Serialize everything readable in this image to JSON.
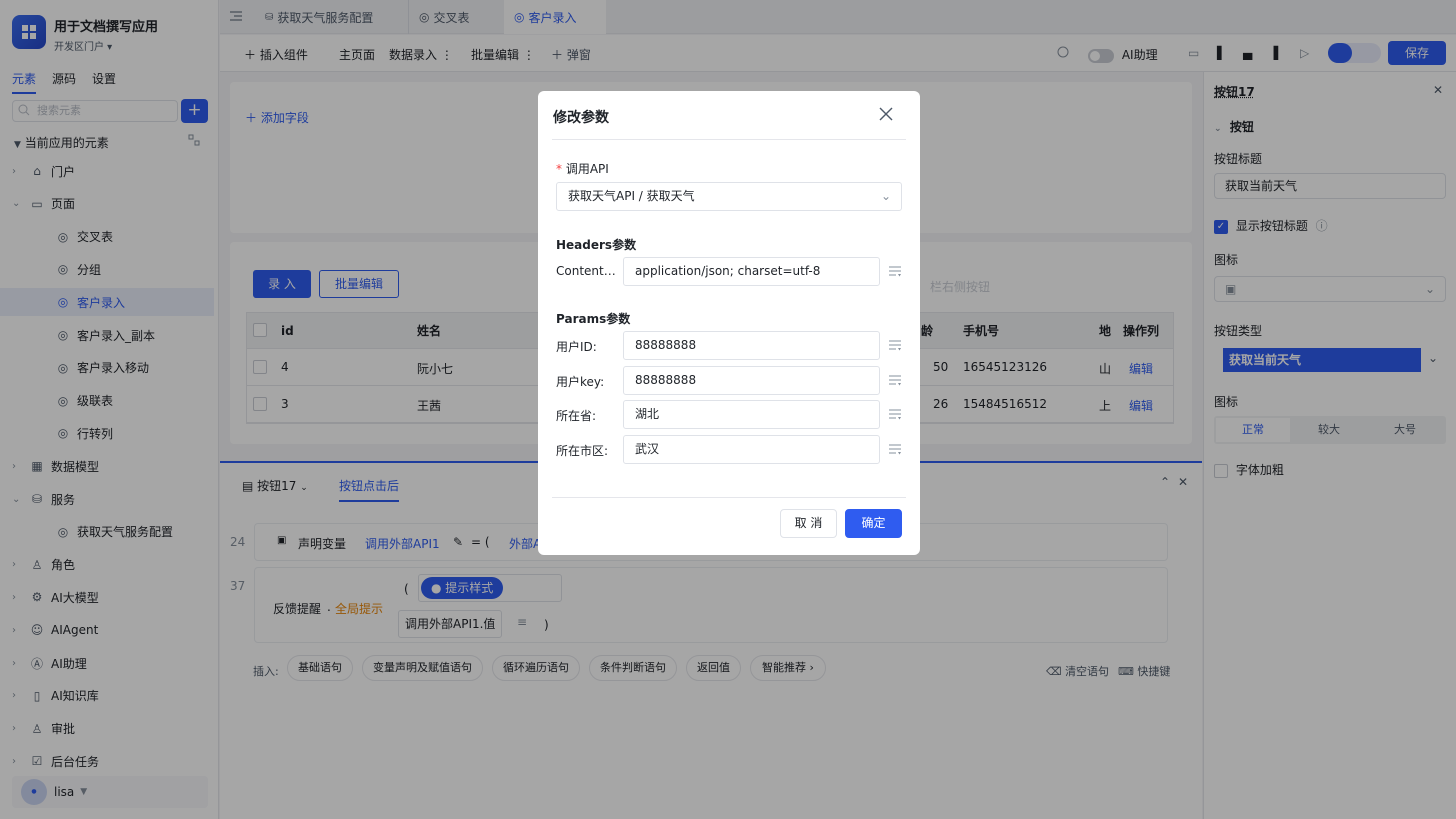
{
  "app": {
    "title": "用于文档撰写应用",
    "subtitle": "开发区门户"
  },
  "sidebar": {
    "tabs": [
      "元素",
      "源码",
      "设置"
    ],
    "search_placeholder": "搜索元素",
    "section_title": "当前应用的元素",
    "items": [
      {
        "label": "门户",
        "level": 0,
        "arrow": "›"
      },
      {
        "label": "页面",
        "level": 0,
        "arrow": "⌄"
      },
      {
        "label": "交叉表",
        "level": 1
      },
      {
        "label": "分组",
        "level": 1
      },
      {
        "label": "客户录入",
        "level": 1,
        "selected": true
      },
      {
        "label": "客户录入_副本",
        "level": 1
      },
      {
        "label": "客户录入移动",
        "level": 1
      },
      {
        "label": "级联表",
        "level": 1
      },
      {
        "label": "行转列",
        "level": 1
      },
      {
        "label": "数据模型",
        "level": 0,
        "arrow": "›"
      },
      {
        "label": "服务",
        "level": 0,
        "arrow": "⌄"
      },
      {
        "label": "获取天气服务配置",
        "level": 1
      },
      {
        "label": "角色",
        "level": 0,
        "arrow": "›"
      },
      {
        "label": "AI大模型",
        "level": 0,
        "arrow": "›"
      },
      {
        "label": "AIAgent",
        "level": 0,
        "arrow": "›"
      },
      {
        "label": "AI助理",
        "level": 0,
        "arrow": "›"
      },
      {
        "label": "AI知识库",
        "level": 0,
        "arrow": "›"
      },
      {
        "label": "审批",
        "level": 0,
        "arrow": "›"
      },
      {
        "label": "后台任务",
        "level": 0,
        "arrow": "›"
      }
    ],
    "user": "lisa"
  },
  "tabs": [
    {
      "label": "获取天气服务配置"
    },
    {
      "label": "交叉表"
    },
    {
      "label": "客户录入",
      "active": true
    }
  ],
  "toolbar": {
    "insert": "插入组件",
    "main_page": "主页面",
    "data_entry": "数据录入",
    "batch_edit": "批量编辑",
    "popup": "弹窗",
    "ai_assist": "AI助理",
    "save": "保存"
  },
  "form_area": {
    "add_field": "添加字段"
  },
  "table": {
    "btn_entry": "录 入",
    "btn_batch": "批量编辑",
    "right_hint": "栏右侧按钮",
    "columns": [
      "id",
      "姓名",
      "龄",
      "手机号",
      "地",
      "操作列"
    ],
    "rows": [
      {
        "id": "4",
        "name": "阮小七",
        "age": "50",
        "phone": "16545123126",
        "region": "山",
        "action": "编辑"
      },
      {
        "id": "3",
        "name": "王茜",
        "age": "26",
        "phone": "15484516512",
        "region": "上",
        "action": "编辑"
      }
    ]
  },
  "logic": {
    "tab_button": "按钮17",
    "tab_after": "按钮点击后",
    "line1_no": "24",
    "line1_decl": "声明变量",
    "line1_var": "调用外部API1",
    "line1_eq": "= (",
    "line1_ext": "外部A",
    "line2_no": "37",
    "line2_fb": "反馈提醒",
    "line2_dot": ".",
    "line2_global": "全局提示",
    "line2_paren_open": "(",
    "line2_style": "提示样式",
    "line2_value": "调用外部API1.值",
    "line2_paren_close": ")",
    "insert_label": "插入:",
    "insert_buttons": [
      "基础语句",
      "变量声明及赋值语句",
      "循环遍历语句",
      "条件判断语句",
      "返回值",
      "智能推荐"
    ],
    "clear": "清空语句",
    "shortcut": "快捷键"
  },
  "right_panel": {
    "title": "按钮17",
    "section": "按钮",
    "label_title": "按钮标题",
    "title_value": "获取当前天气",
    "show_title": "显示按钮标题",
    "icon_label": "图标",
    "type_label": "按钮类型",
    "type_value": "获取当前天气",
    "size_label": "图标",
    "sizes": [
      "正常",
      "较大",
      "大号"
    ],
    "bold": "字体加粗"
  },
  "modal": {
    "title": "修改参数",
    "api_label": "调用API",
    "api_value": "获取天气API / 获取天气",
    "headers_title": "Headers参数",
    "headers": [
      {
        "label": "Content-Type:",
        "value": "application/json; charset=utf-8"
      }
    ],
    "params_title": "Params参数",
    "params": [
      {
        "label": "用户ID:",
        "value": "88888888"
      },
      {
        "label": "用户key:",
        "value": "88888888"
      },
      {
        "label": "所在省:",
        "value": "湖北"
      },
      {
        "label": "所在市区:",
        "value": "武汉"
      }
    ],
    "cancel": "取 消",
    "ok": "确定"
  },
  "colors": {
    "primary": "#2f5cf0",
    "accent_orange": "#e8860c",
    "required": "#f53f3f"
  }
}
